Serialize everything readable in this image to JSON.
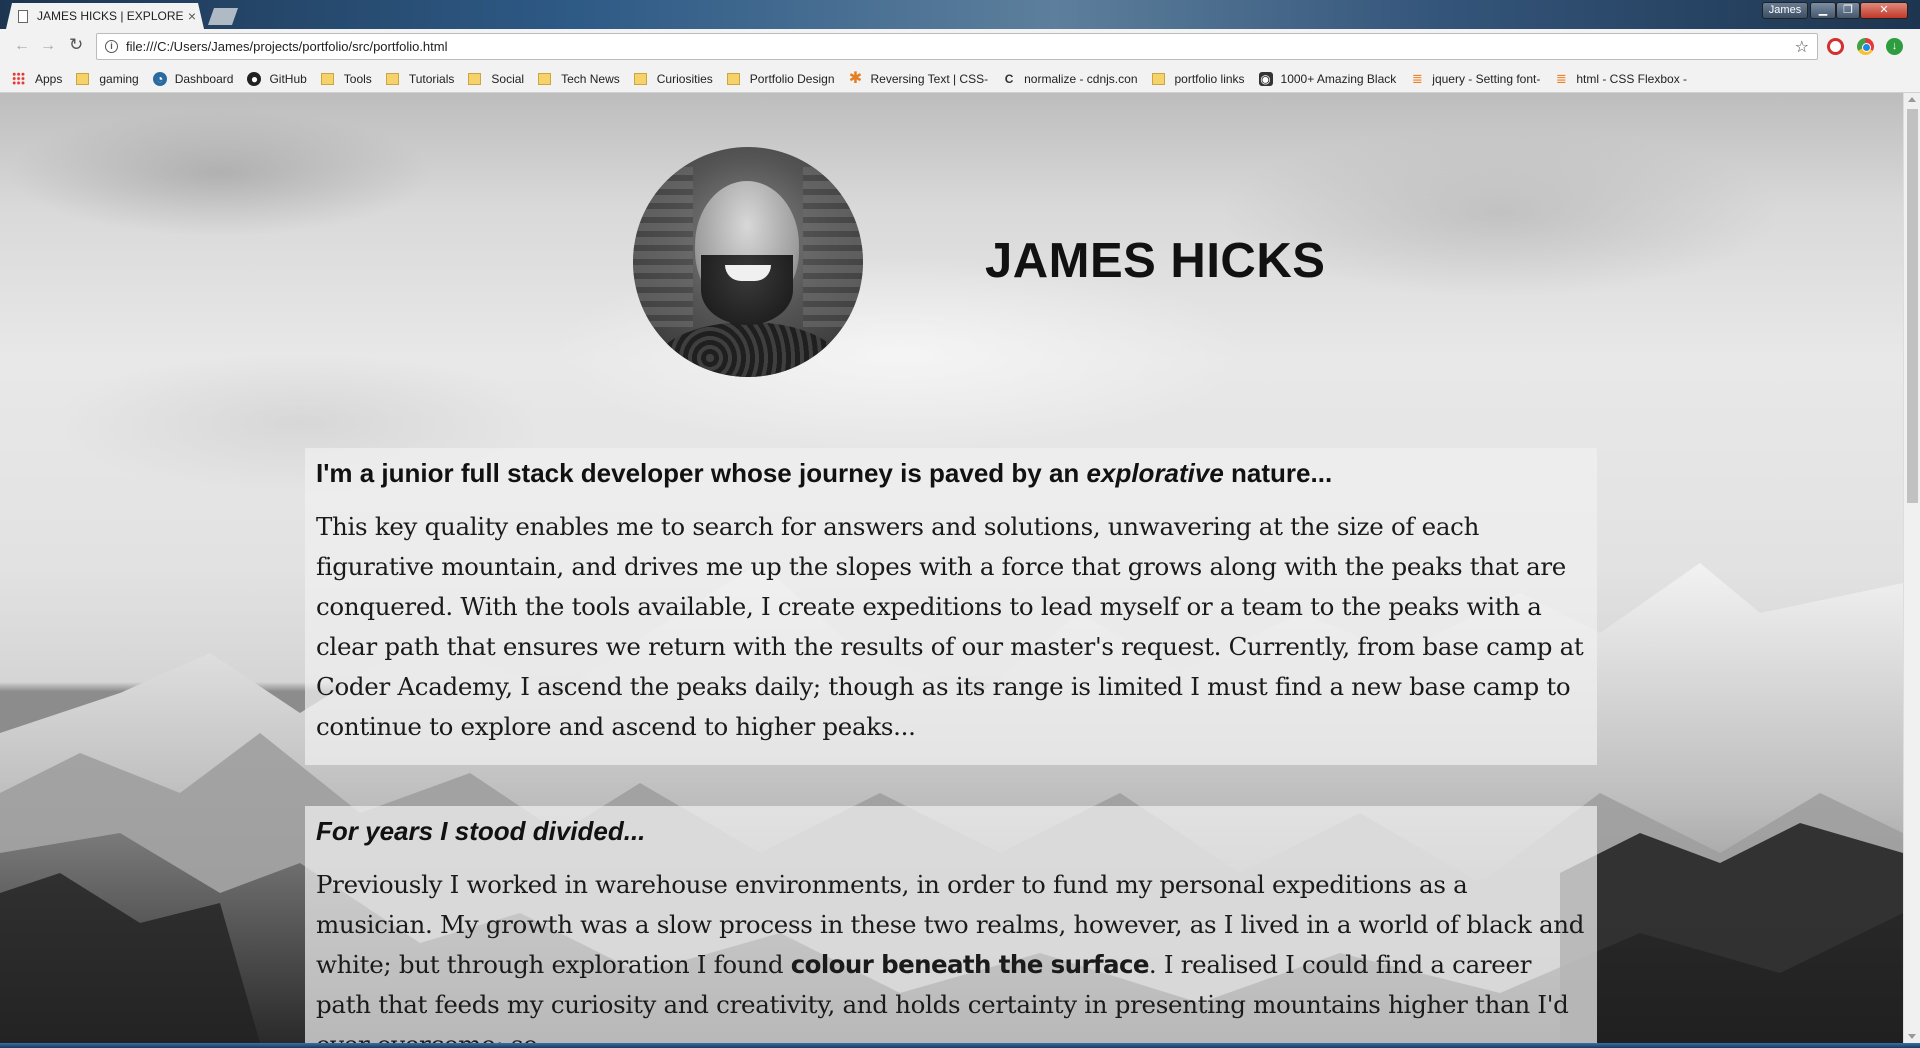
{
  "browser": {
    "tab_title": "JAMES HICKS | EXPLORE",
    "tab_close": "×",
    "profile_name": "James",
    "window_controls": {
      "minimize": "▁",
      "maximize": "❐",
      "close": "✕"
    },
    "nav": {
      "back": "←",
      "forward": "→",
      "reload": "↻"
    },
    "url": "file:///C:/Users/James/projects/portfolio/src/portfolio.html",
    "bookmarks": [
      {
        "label": "Apps",
        "icon": "apps-grid-icon"
      },
      {
        "label": "gaming",
        "icon": "folder-icon"
      },
      {
        "label": "Dashboard",
        "icon": "dashboard-icon"
      },
      {
        "label": "GitHub",
        "icon": "github-icon"
      },
      {
        "label": "Tools",
        "icon": "folder-icon"
      },
      {
        "label": "Tutorials",
        "icon": "folder-icon"
      },
      {
        "label": "Social",
        "icon": "folder-icon"
      },
      {
        "label": "Tech News",
        "icon": "folder-icon"
      },
      {
        "label": "Curiosities",
        "icon": "folder-icon"
      },
      {
        "label": "Portfolio Design",
        "icon": "folder-icon"
      },
      {
        "label": "Reversing Text | CSS-",
        "icon": "css-tricks-icon"
      },
      {
        "label": "normalize - cdnjs.con",
        "icon": "cdnjs-icon"
      },
      {
        "label": "portfolio links",
        "icon": "folder-icon"
      },
      {
        "label": "1000+ Amazing Black",
        "icon": "instagram-icon"
      },
      {
        "label": "jquery - Setting font-",
        "icon": "stackoverflow-icon"
      },
      {
        "label": "html - CSS Flexbox - ",
        "icon": "stackoverflow-icon"
      }
    ]
  },
  "page": {
    "name": "JAMES HICKS",
    "section1": {
      "heading_before": "I'm a junior full stack developer whose journey is paved by an ",
      "heading_em": "explorative",
      "heading_after": " nature...",
      "body": "This key quality enables me to search for answers and solutions, unwavering at the size of each figurative mountain, and drives me up the slopes with a force that grows along with the peaks that are conquered. With the tools available, I create expeditions to lead myself or a team to the peaks with a clear path that ensures we return with the results of our master's request. Currently, from base camp at Coder Academy, I ascend the peaks daily; though as its range is limited I must find a new base camp to continue to explore and ascend to higher peaks..."
    },
    "section2": {
      "heading": "For years I stood divided...",
      "body_before": "Previously I worked in warehouse environments, in order to fund my personal expeditions as a musician. My growth was a slow process in these two realms, however, as I lived in a world of black and white; but through exploration I found ",
      "body_bold": "colour beneath the surface",
      "body_after": ". I realised I could find a career path that feeds my curiosity and creativity, and holds certainty in presenting mountains higher than I'd ever overcome; so"
    }
  }
}
